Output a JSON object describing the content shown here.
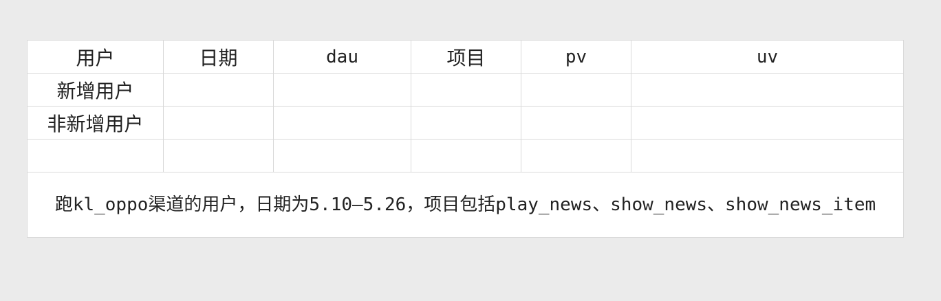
{
  "table": {
    "headers": [
      "用户",
      "日期",
      "dau",
      "项目",
      "pv",
      "uv"
    ],
    "rows": [
      [
        "新增用户",
        "",
        "",
        "",
        "",
        ""
      ],
      [
        "非新增用户",
        "",
        "",
        "",
        "",
        ""
      ],
      [
        "",
        "",
        "",
        "",
        "",
        ""
      ]
    ],
    "note": "跑kl_oppo渠道的用户，日期为5.10—5.26，项目包括play_news、show_news、show_news_item"
  }
}
